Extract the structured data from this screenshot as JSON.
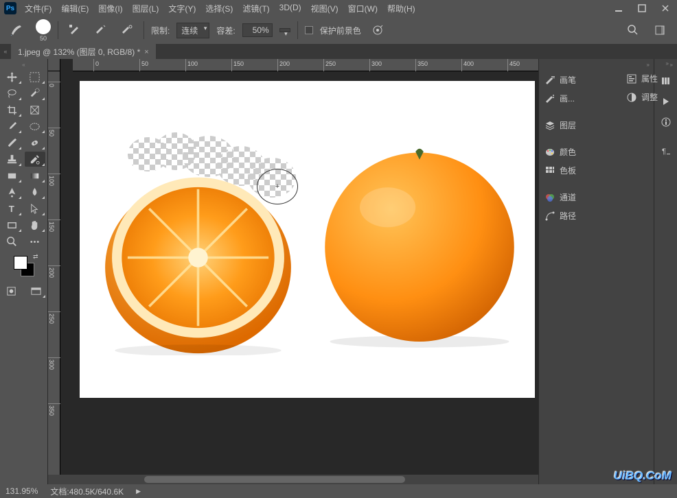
{
  "app": {
    "logo": "Ps"
  },
  "menu": [
    "文件(F)",
    "编辑(E)",
    "图像(I)",
    "图层(L)",
    "文字(Y)",
    "选择(S)",
    "滤镜(T)",
    "3D(D)",
    "视图(V)",
    "窗口(W)",
    "帮助(H)"
  ],
  "options": {
    "brush_size": "50",
    "limit_label": "限制:",
    "limit_value": "连续",
    "tolerance_label": "容差:",
    "tolerance_value": "50%",
    "protect_fg": "保护前景色"
  },
  "doctab": {
    "title": "1.jpeg @ 132% (图层 0, RGB/8) *"
  },
  "ruler_h": [
    "0",
    "50",
    "100",
    "150",
    "200",
    "250",
    "300",
    "350",
    "400",
    "450"
  ],
  "ruler_v": [
    "0",
    "50",
    "100",
    "150",
    "200",
    "250",
    "300",
    "350"
  ],
  "panels_left": [
    {
      "icon": "brush",
      "label": "画笔"
    },
    {
      "icon": "brush-list",
      "label": "画..."
    },
    {
      "sep": true
    },
    {
      "icon": "layers",
      "label": "图层"
    },
    {
      "sep": true
    },
    {
      "icon": "palette",
      "label": "颜色"
    },
    {
      "icon": "swatches",
      "label": "色板"
    },
    {
      "sep": true
    },
    {
      "icon": "channels",
      "label": "通道"
    },
    {
      "icon": "paths",
      "label": "路径"
    }
  ],
  "panels_narrow": [
    "history",
    "actions",
    "info",
    "char"
  ],
  "panels_float": [
    {
      "icon": "properties",
      "label": "属性"
    },
    {
      "icon": "adjust",
      "label": "调整"
    }
  ],
  "status": {
    "zoom": "131.95%",
    "doc_label": "文档:",
    "doc_value": "480.5K/640.6K"
  },
  "watermark": "UiBQ.CoM"
}
